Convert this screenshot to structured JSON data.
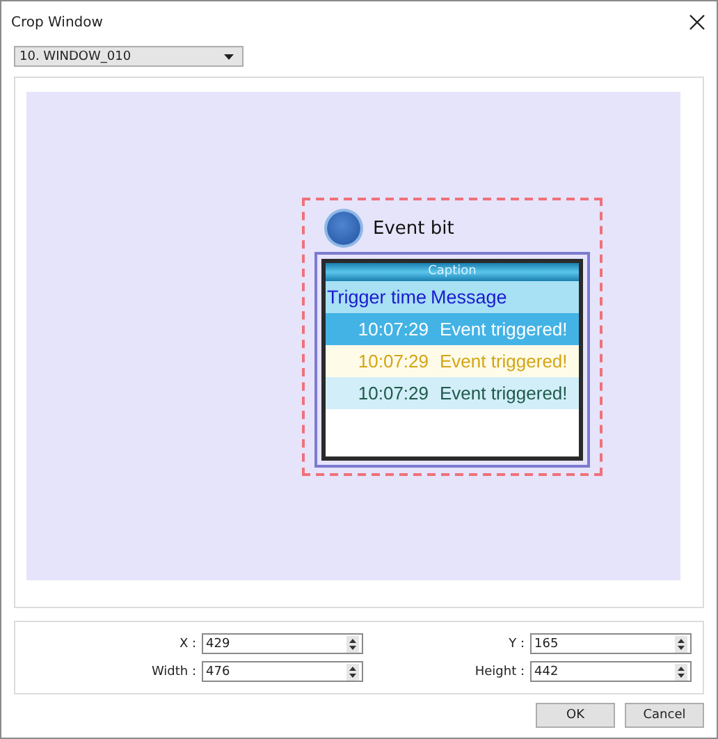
{
  "window": {
    "title": "Crop Window"
  },
  "window_select": {
    "value": "10. WINDOW_010"
  },
  "preview": {
    "event_bit": {
      "label": "Event bit"
    },
    "alarm_display": {
      "caption": "Caption",
      "columns": [
        "Trigger time",
        "Message"
      ],
      "rows": [
        {
          "time": "10:07:29",
          "message": "Event triggered!",
          "selected": true,
          "color": "#ffffff"
        },
        {
          "time": "10:07:29",
          "message": "Event triggered!",
          "selected": false,
          "color": "#d4a514"
        },
        {
          "time": "10:07:29",
          "message": "Event triggered!",
          "selected": false,
          "color": "#1e5a4c"
        }
      ]
    }
  },
  "fields": [
    {
      "label": "X :",
      "value": "429"
    },
    {
      "label": "Y :",
      "value": "165"
    },
    {
      "label": "Width :",
      "value": "476"
    },
    {
      "label": "Height :",
      "value": "442"
    }
  ],
  "buttons": [
    "OK",
    "Cancel"
  ]
}
